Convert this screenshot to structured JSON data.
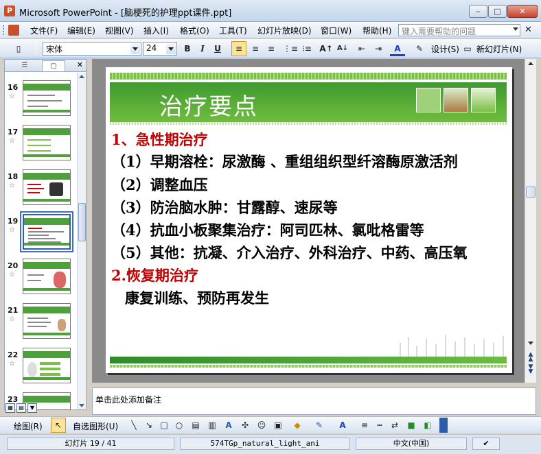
{
  "window": {
    "title": "Microsoft PowerPoint - [脑梗死的护理ppt课件.ppt]",
    "app_icon": "P",
    "minimize": "‒",
    "maximize": "□",
    "close": "✕"
  },
  "menu": {
    "items": [
      "文件(F)",
      "编辑(E)",
      "视图(V)",
      "插入(I)",
      "格式(O)",
      "工具(T)",
      "幻灯片放映(D)",
      "窗口(W)",
      "帮助(H)"
    ],
    "help_placeholder": "键入需要帮助的问题",
    "close": "✕"
  },
  "toolbar": {
    "font_name": "宋体",
    "font_size": "24",
    "bold": "B",
    "italic": "I",
    "underline": "U",
    "design_label": "设计(S)",
    "new_slide_label": "新幻灯片(N)"
  },
  "left_panel": {
    "close": "✕",
    "slides": [
      {
        "num": "16"
      },
      {
        "num": "17"
      },
      {
        "num": "18"
      },
      {
        "num": "19"
      },
      {
        "num": "20"
      },
      {
        "num": "21"
      },
      {
        "num": "22"
      },
      {
        "num": "23"
      }
    ],
    "selected_index": 3
  },
  "slide": {
    "title": "治疗要点",
    "lines": [
      {
        "text": "1、急性期治疗",
        "color": "red"
      },
      {
        "text": "（1）早期溶栓：尿激酶 、重组组织型纤溶酶原激活剂",
        "color": "black"
      },
      {
        "text": "（2）调整血压",
        "color": "black"
      },
      {
        "text": "（3）防治脑水肿：甘露醇、速尿等",
        "color": "black"
      },
      {
        "text": "（4）抗血小板聚集治疗：阿司匹林、氯吡格雷等",
        "color": "black"
      },
      {
        "text": "（5）其他：抗凝、介入治疗、外科治疗、中药、高压氧",
        "color": "black"
      },
      {
        "text": "2.恢复期治疗",
        "color": "red"
      },
      {
        "text": "康复训练、预防再发生",
        "color": "black"
      }
    ]
  },
  "notes": {
    "placeholder": "单击此处添加备注"
  },
  "drawbar": {
    "draw_label": "绘图(R)",
    "autoshape_label": "自选图形(U)"
  },
  "status": {
    "slide_info": "幻灯片 19 / 41",
    "design_name": "574TGp_natural_light_ani",
    "language": "中文(中国)"
  },
  "colors": {
    "accent_green": "#4ea03c",
    "heading_red": "#c00000"
  }
}
